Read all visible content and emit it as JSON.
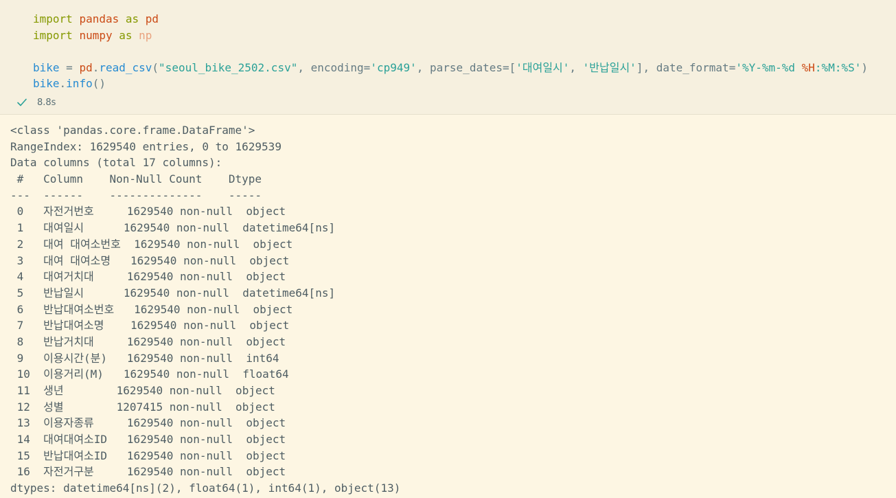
{
  "code_cell": {
    "lines": [
      [
        {
          "t": "import",
          "c": "kw"
        },
        {
          "t": " ",
          "c": "plain"
        },
        {
          "t": "pandas",
          "c": "mod"
        },
        {
          "t": " ",
          "c": "plain"
        },
        {
          "t": "as",
          "c": "kw"
        },
        {
          "t": " ",
          "c": "plain"
        },
        {
          "t": "pd",
          "c": "alias"
        }
      ],
      [
        {
          "t": "import",
          "c": "kw"
        },
        {
          "t": " ",
          "c": "plain"
        },
        {
          "t": "numpy",
          "c": "mod"
        },
        {
          "t": " ",
          "c": "plain"
        },
        {
          "t": "as",
          "c": "kw"
        },
        {
          "t": " ",
          "c": "plain"
        },
        {
          "t": "np",
          "c": "alias-faded"
        }
      ],
      [],
      [
        {
          "t": "bike",
          "c": "var"
        },
        {
          "t": " = ",
          "c": "plain"
        },
        {
          "t": "pd",
          "c": "alias"
        },
        {
          "t": ".",
          "c": "plain"
        },
        {
          "t": "read_csv",
          "c": "fn"
        },
        {
          "t": "(",
          "c": "plain"
        },
        {
          "t": "\"seoul_bike_2502.csv\"",
          "c": "str"
        },
        {
          "t": ", encoding=",
          "c": "plain"
        },
        {
          "t": "'cp949'",
          "c": "str"
        },
        {
          "t": ", parse_dates=[",
          "c": "plain"
        },
        {
          "t": "'대여일시'",
          "c": "str"
        },
        {
          "t": ", ",
          "c": "plain"
        },
        {
          "t": "'반납일시'",
          "c": "str"
        },
        {
          "t": "], date_format=",
          "c": "plain"
        },
        {
          "t": "'%Y-%m-%d ",
          "c": "str"
        },
        {
          "t": "%H",
          "c": "mod"
        },
        {
          "t": ":%M:%S'",
          "c": "str"
        },
        {
          "t": ")",
          "c": "plain"
        }
      ],
      [
        {
          "t": "bike",
          "c": "var"
        },
        {
          "t": ".",
          "c": "plain"
        },
        {
          "t": "info",
          "c": "fn"
        },
        {
          "t": "()",
          "c": "plain"
        }
      ]
    ],
    "status": {
      "icon": "checkmark-icon",
      "duration": "8.8s",
      "color": "#2aa198"
    }
  },
  "output": {
    "lines": [
      "<class 'pandas.core.frame.DataFrame'>",
      "RangeIndex: 1629540 entries, 0 to 1629539",
      "Data columns (total 17 columns):",
      " #   Column    Non-Null Count    Dtype",
      "---  ------    --------------    -----",
      " 0   자전거번호     1629540 non-null  object",
      " 1   대여일시      1629540 non-null  datetime64[ns]",
      " 2   대여 대여소번호  1629540 non-null  object",
      " 3   대여 대여소명   1629540 non-null  object",
      " 4   대여거치대     1629540 non-null  object",
      " 5   반납일시      1629540 non-null  datetime64[ns]",
      " 6   반납대여소번호   1629540 non-null  object",
      " 7   반납대여소명    1629540 non-null  object",
      " 8   반납거치대     1629540 non-null  object",
      " 9   이용시간(분)   1629540 non-null  int64",
      " 10  이용거리(M)   1629540 non-null  float64",
      " 11  생년        1629540 non-null  object",
      " 12  성별        1207415 non-null  object",
      " 13  이용자종류     1629540 non-null  object",
      " 14  대여대여소ID   1629540 non-null  object",
      " 15  반납대여소ID   1629540 non-null  object",
      " 16  자전거구분     1629540 non-null  object",
      "dtypes: datetime64[ns](2), float64(1), int64(1), object(13)"
    ]
  },
  "colors": {
    "background": "#fdf6e3",
    "cell_background": "#f6f0df",
    "keyword": "#859900",
    "module": "#cb4b16",
    "variable": "#268bd2",
    "string": "#2aa198",
    "text": "#657b83"
  }
}
